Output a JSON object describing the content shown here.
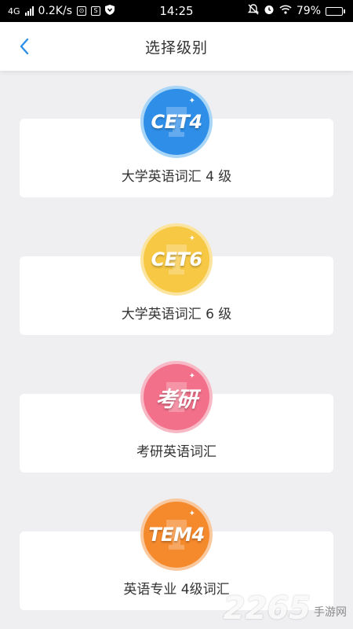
{
  "status_bar": {
    "network": "4G",
    "speed": "0.2K/s",
    "time": "14:25",
    "battery": "79%"
  },
  "header": {
    "title": "选择级别",
    "back_icon": "chevron-left-icon"
  },
  "levels": [
    {
      "badge": "CET4",
      "label": "大学英语词汇 4 级",
      "color": "#2f8fe8",
      "ring": "#a9d6f7"
    },
    {
      "badge": "CET6",
      "label": "大学英语词汇 6 级",
      "color": "#f7c844",
      "ring": "#fbe4a0"
    },
    {
      "badge": "考研",
      "label": "考研英语词汇",
      "color": "#f2708a",
      "ring": "#f8b9c6"
    },
    {
      "badge": "TEM4",
      "label": "英语专业 4级词汇",
      "color": "#f58a2d",
      "ring": "#f9c89e"
    }
  ],
  "watermark": {
    "number": "2265",
    "text": "手游网"
  }
}
